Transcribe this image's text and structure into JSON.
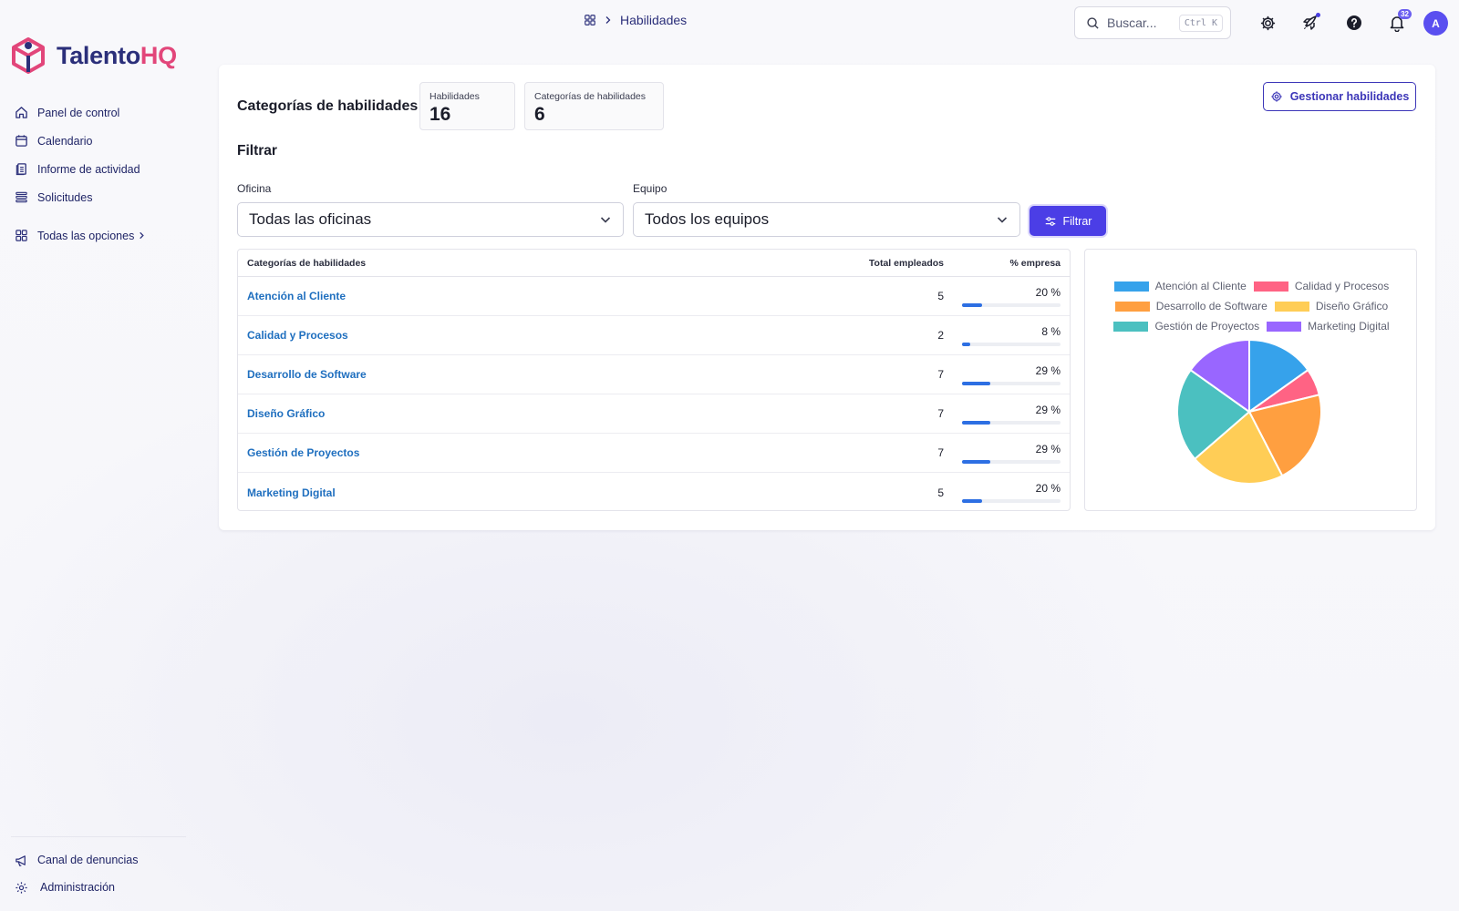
{
  "app": {
    "brand_main": "Talento",
    "brand_accent": "HQ",
    "brand_color": "#2b2f7a",
    "accent_color": "#e2467a"
  },
  "sidebar": {
    "items": [
      {
        "label": "Panel de control",
        "icon": "home-icon"
      },
      {
        "label": "Calendario",
        "icon": "calendar-icon"
      },
      {
        "label": "Informe de actividad",
        "icon": "report-icon"
      },
      {
        "label": "Solicitudes",
        "icon": "list-icon"
      }
    ],
    "all_options": {
      "label": "Todas las opciones",
      "icon": "grid-icon"
    },
    "bottom_items": [
      {
        "label": "Canal de denuncias",
        "icon": "megaphone-icon"
      },
      {
        "label": "Administración",
        "icon": "gear-icon"
      }
    ]
  },
  "topbar": {
    "breadcrumb": {
      "current": "Habilidades"
    },
    "search": {
      "placeholder": "Buscar...",
      "shortcut": "Ctrl K"
    },
    "notifications_badge": "32",
    "avatar_initial": "A"
  },
  "main": {
    "title": "Categorías de habilidades",
    "stats": [
      {
        "label": "Habilidades",
        "value": "16"
      },
      {
        "label": "Categorías de habilidades",
        "value": "6"
      }
    ],
    "manage_button": "Gestionar habilidades",
    "filter": {
      "title": "Filtrar",
      "office_label": "Oficina",
      "office_value": "Todas las oficinas",
      "team_label": "Equipo",
      "team_value": "Todos los equipos",
      "button": "Filtrar"
    },
    "table": {
      "headers": [
        "Categorías de habilidades",
        "Total empleados",
        "% empresa"
      ],
      "rows": [
        {
          "name": "Atención al Cliente",
          "total": "5",
          "pct": "20 %",
          "pct_value": 20
        },
        {
          "name": "Calidad y Procesos",
          "total": "2",
          "pct": "8 %",
          "pct_value": 8
        },
        {
          "name": "Desarrollo de Software",
          "total": "7",
          "pct": "29 %",
          "pct_value": 29
        },
        {
          "name": "Diseño Gráfico",
          "total": "7",
          "pct": "29 %",
          "pct_value": 29
        },
        {
          "name": "Gestión de Proyectos",
          "total": "7",
          "pct": "29 %",
          "pct_value": 29
        },
        {
          "name": "Marketing Digital",
          "total": "5",
          "pct": "20 %",
          "pct_value": 20
        }
      ]
    }
  },
  "chart_data": {
    "type": "pie",
    "categories": [
      "Atención al Cliente",
      "Calidad y Procesos",
      "Desarrollo de Software",
      "Diseño Gráfico",
      "Gestión de Proyectos",
      "Marketing Digital"
    ],
    "values": [
      5,
      2,
      7,
      7,
      7,
      5
    ],
    "colors": [
      "#36a2eb",
      "#ff6384",
      "#ff9f40",
      "#ffcd56",
      "#4bc0c0",
      "#9966ff"
    ],
    "legend": "top"
  }
}
